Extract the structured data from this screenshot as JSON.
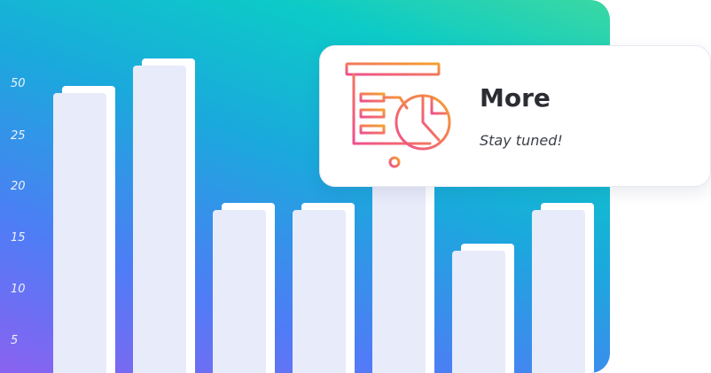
{
  "chart_data": {
    "type": "bar",
    "y_tick_labels": [
      "50",
      "25",
      "20",
      "15",
      "10",
      "5"
    ],
    "values": [
      28,
      52,
      14,
      14,
      18,
      10,
      14
    ],
    "grid": false,
    "legend": "none"
  },
  "card": {
    "title": "More",
    "subtitle": "Stay tuned!",
    "icon": "presentation-chart-icon",
    "icon_gradient": [
      "#ef4e8f",
      "#f6a02e"
    ]
  },
  "colors": {
    "gradient_start": "#8a62f0",
    "gradient_mid": "#1aa9dc",
    "gradient_end": "#3bd8a2",
    "bar": "#e8ebfa"
  }
}
